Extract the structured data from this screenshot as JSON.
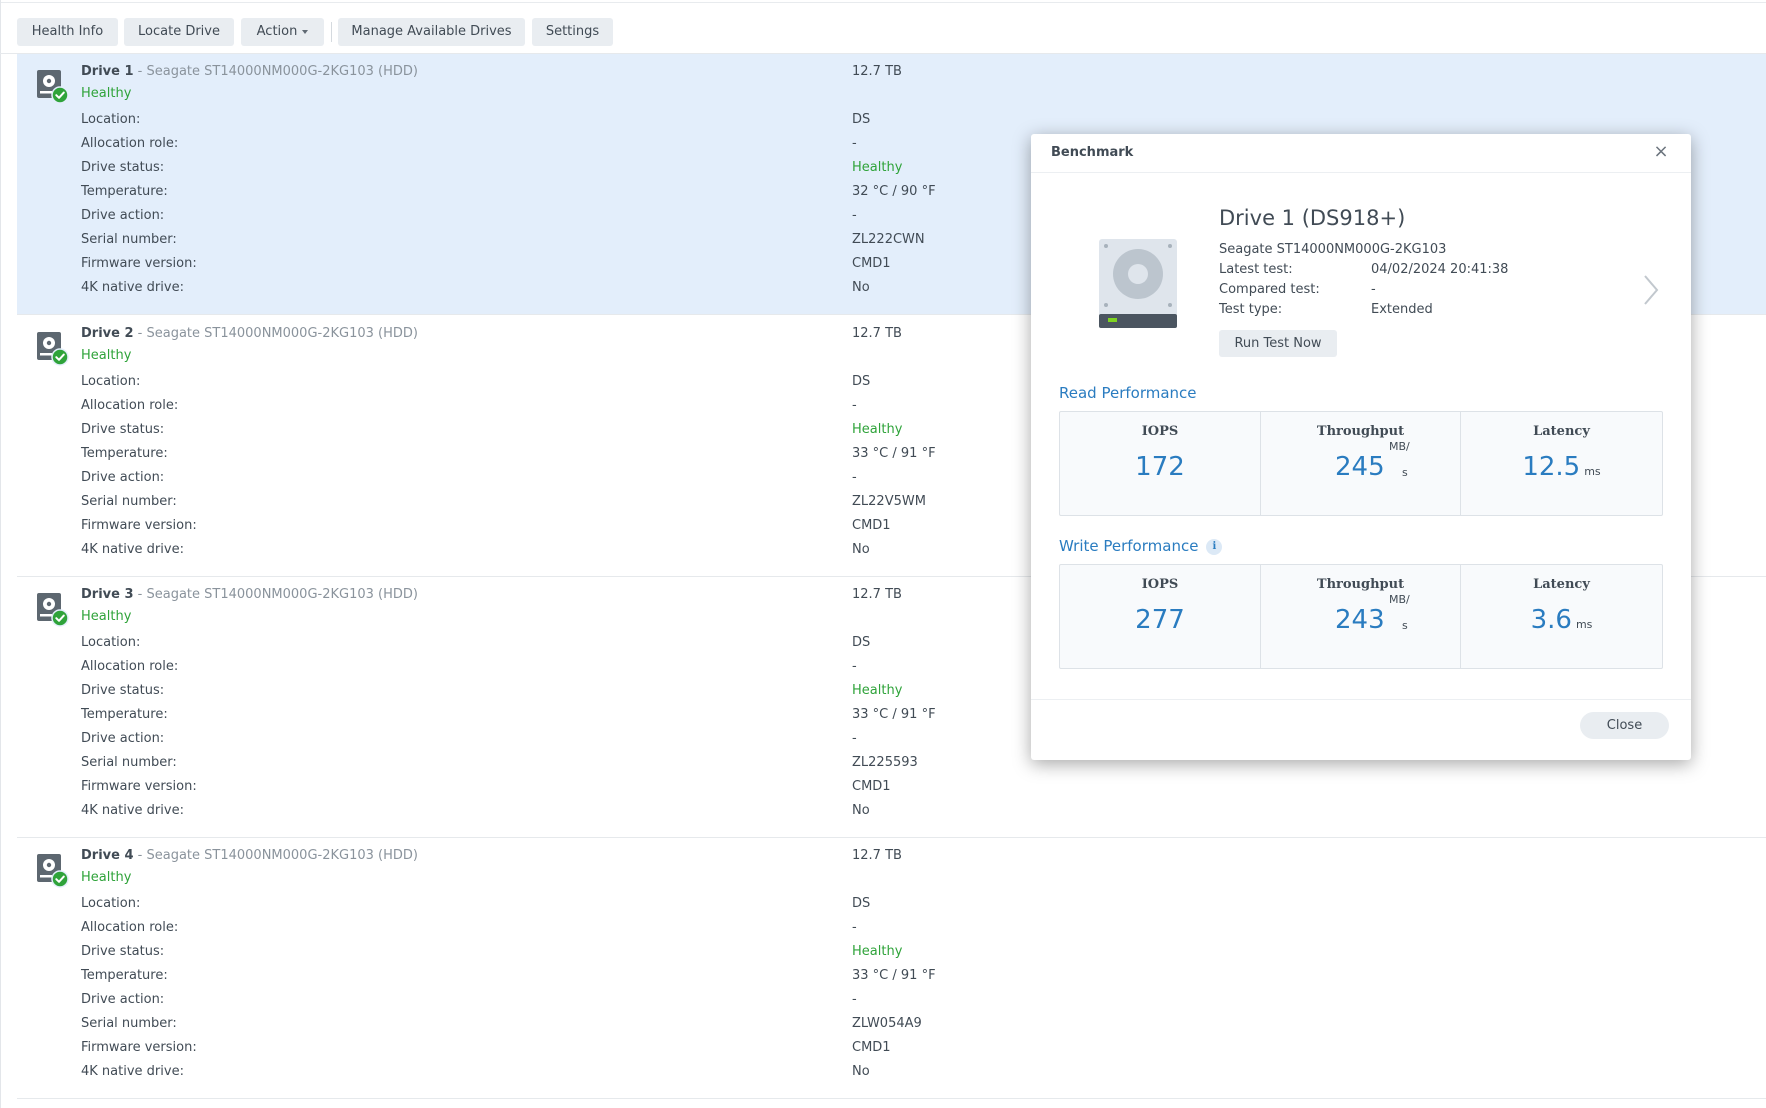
{
  "toolbar": {
    "health_info": "Health Info",
    "locate_drive": "Locate Drive",
    "action": "Action",
    "manage_drives": "Manage Available Drives",
    "settings": "Settings"
  },
  "labels": {
    "location": "Location:",
    "allocation_role": "Allocation role:",
    "drive_status": "Drive status:",
    "temperature": "Temperature:",
    "drive_action": "Drive action:",
    "serial_number": "Serial number:",
    "firmware_version": "Firmware version:",
    "native_4k": "4K native drive:"
  },
  "drives": [
    {
      "name": "Drive 1",
      "model": " - Seagate ST14000NM000G-2KG103 (HDD)",
      "status": "Healthy",
      "size": "12.7 TB",
      "location": "DS",
      "allocation_role": "-",
      "drive_status": "Healthy",
      "temperature": "32 °C / 90 °F",
      "drive_action": "-",
      "serial_number": "ZL222CWN",
      "firmware_version": "CMD1",
      "native_4k": "No"
    },
    {
      "name": "Drive 2",
      "model": " - Seagate ST14000NM000G-2KG103 (HDD)",
      "status": "Healthy",
      "size": "12.7 TB",
      "location": "DS",
      "allocation_role": "-",
      "drive_status": "Healthy",
      "temperature": "33 °C / 91 °F",
      "drive_action": "-",
      "serial_number": "ZL22V5WM",
      "firmware_version": "CMD1",
      "native_4k": "No"
    },
    {
      "name": "Drive 3",
      "model": " - Seagate ST14000NM000G-2KG103 (HDD)",
      "status": "Healthy",
      "size": "12.7 TB",
      "location": "DS",
      "allocation_role": "-",
      "drive_status": "Healthy",
      "temperature": "33 °C / 91 °F",
      "drive_action": "-",
      "serial_number": "ZL225593",
      "firmware_version": "CMD1",
      "native_4k": "No"
    },
    {
      "name": "Drive 4",
      "model": " - Seagate ST14000NM000G-2KG103 (HDD)",
      "status": "Healthy",
      "size": "12.7 TB",
      "location": "DS",
      "allocation_role": "-",
      "drive_status": "Healthy",
      "temperature": "33 °C / 91 °F",
      "drive_action": "-",
      "serial_number": "ZLW054A9",
      "firmware_version": "CMD1",
      "native_4k": "No"
    }
  ],
  "benchmark": {
    "title": "Benchmark",
    "close_icon": "×",
    "drive_title": "Drive 1 (DS918+)",
    "model": "Seagate ST14000NM000G-2KG103",
    "latest_test_label": "Latest test:",
    "latest_test": "04/02/2024 20:41:38",
    "compared_test_label": "Compared test:",
    "compared_test": "-",
    "test_type_label": "Test type:",
    "test_type": "Extended",
    "run_test": "Run Test Now",
    "close": "Close",
    "read": {
      "title": "Read Performance",
      "iops_label": "IOPS",
      "iops": "172",
      "throughput_label": "Throughput",
      "throughput": "245",
      "throughput_unit_top": "MB/",
      "throughput_unit_bottom": "s",
      "latency_label": "Latency",
      "latency": "12.5",
      "latency_unit": "ms"
    },
    "write": {
      "title": "Write Performance",
      "info_icon": "i",
      "iops_label": "IOPS",
      "iops": "277",
      "throughput_label": "Throughput",
      "throughput": "243",
      "throughput_unit_top": "MB/",
      "throughput_unit_bottom": "s",
      "latency_label": "Latency",
      "latency": "3.6",
      "latency_unit": "ms"
    }
  },
  "colors": {
    "healthy": "#2fa33a",
    "accent": "#2a7cc0",
    "selected_row": "#e3eefb"
  }
}
